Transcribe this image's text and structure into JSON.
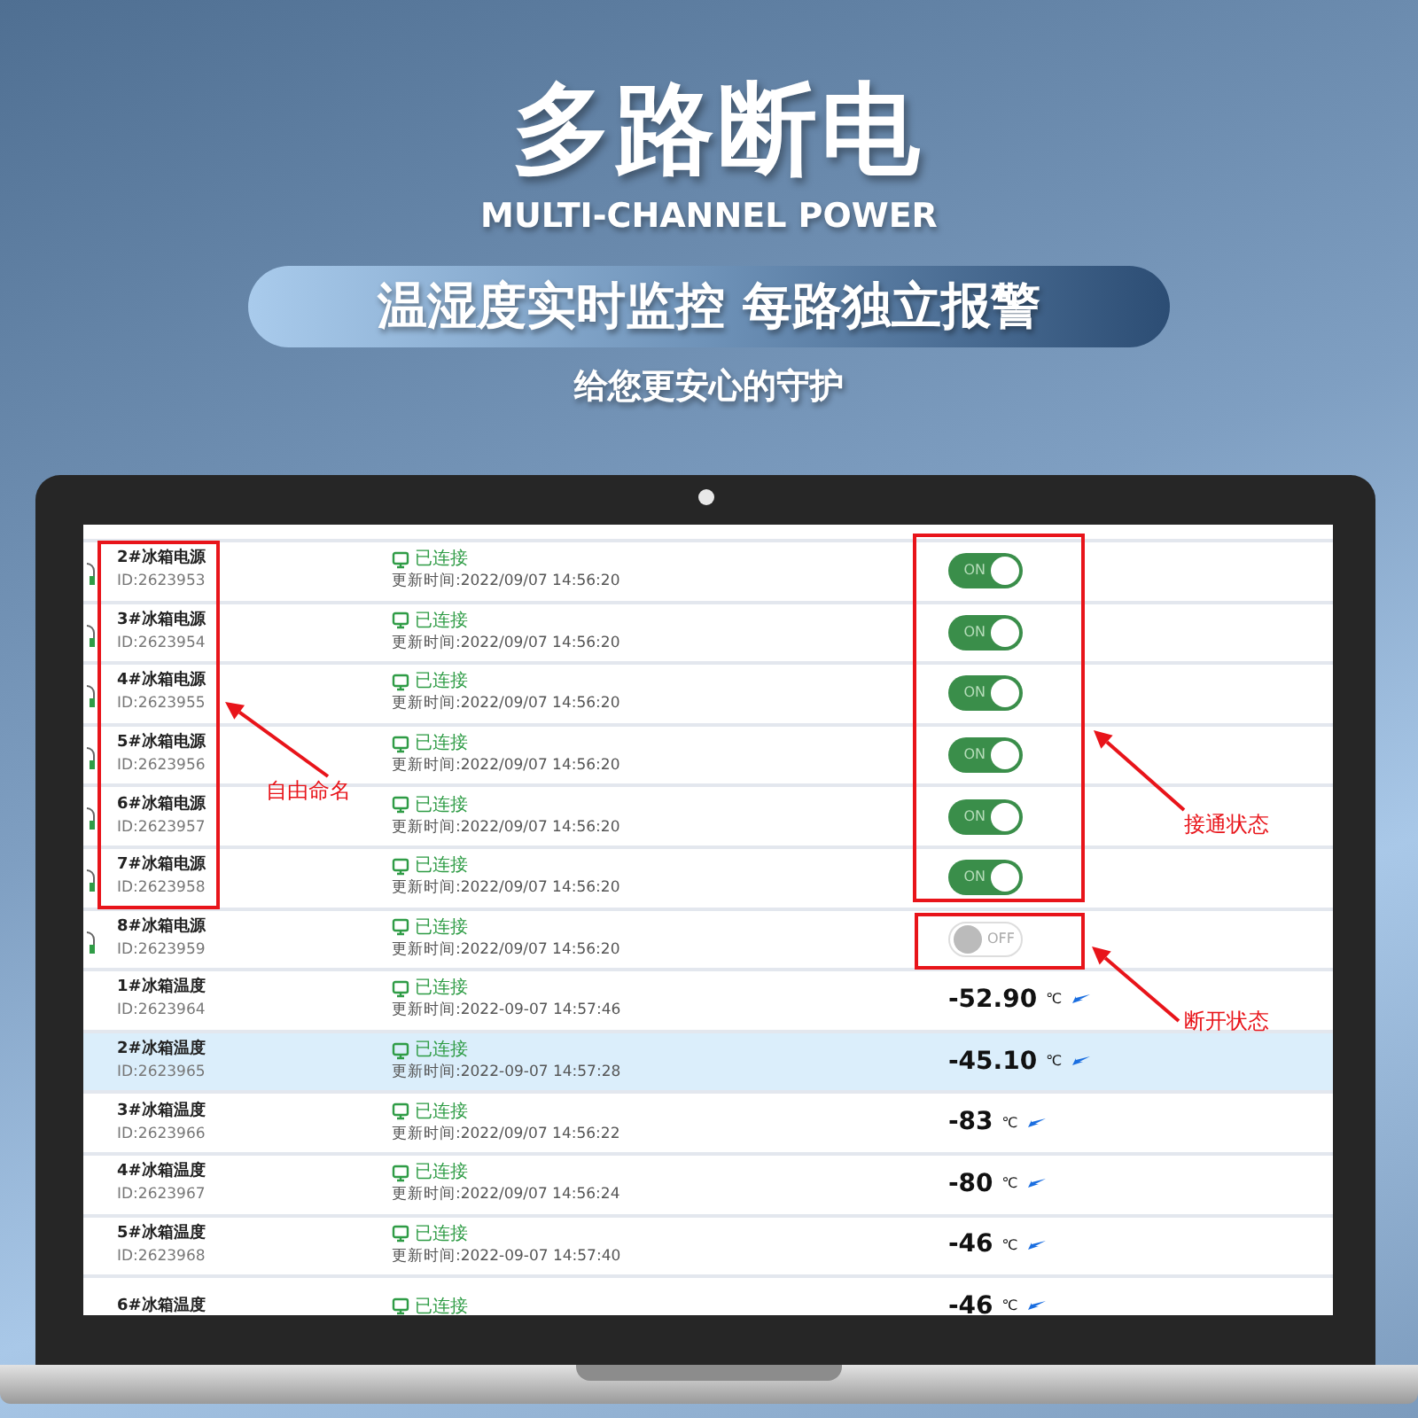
{
  "banner": {
    "title": "多路断电",
    "subtitle": "MULTI-CHANNEL POWER",
    "pill": "温湿度实时监控 每路独立报警",
    "tagline": "给您更安心的守护"
  },
  "rows": [
    {
      "kind": "switch",
      "name": "2#冰箱电源",
      "id": "ID:2623953",
      "status": "已连接",
      "time": "更新时间:2022/09/07 14:56:20",
      "on": true,
      "switch_label": "ON",
      "selected": false
    },
    {
      "kind": "switch",
      "name": "3#冰箱电源",
      "id": "ID:2623954",
      "status": "已连接",
      "time": "更新时间:2022/09/07 14:56:20",
      "on": true,
      "switch_label": "ON",
      "selected": false
    },
    {
      "kind": "switch",
      "name": "4#冰箱电源",
      "id": "ID:2623955",
      "status": "已连接",
      "time": "更新时间:2022/09/07 14:56:20",
      "on": true,
      "switch_label": "ON",
      "selected": false
    },
    {
      "kind": "switch",
      "name": "5#冰箱电源",
      "id": "ID:2623956",
      "status": "已连接",
      "time": "更新时间:2022/09/07 14:56:20",
      "on": true,
      "switch_label": "ON",
      "selected": false
    },
    {
      "kind": "switch",
      "name": "6#冰箱电源",
      "id": "ID:2623957",
      "status": "已连接",
      "time": "更新时间:2022/09/07 14:56:20",
      "on": true,
      "switch_label": "ON",
      "selected": false
    },
    {
      "kind": "switch",
      "name": "7#冰箱电源",
      "id": "ID:2623958",
      "status": "已连接",
      "time": "更新时间:2022/09/07 14:56:20",
      "on": true,
      "switch_label": "ON",
      "selected": false
    },
    {
      "kind": "switch",
      "name": "8#冰箱电源",
      "id": "ID:2623959",
      "status": "已连接",
      "time": "更新时间:2022/09/07 14:56:20",
      "on": false,
      "switch_label": "OFF",
      "selected": false
    },
    {
      "kind": "temperature",
      "name": "1#冰箱温度",
      "id": "ID:2623964",
      "status": "已连接",
      "time": "更新时间:2022-09-07 14:57:46",
      "value": "-52.90",
      "unit": "℃",
      "selected": false
    },
    {
      "kind": "temperature",
      "name": "2#冰箱温度",
      "id": "ID:2623965",
      "status": "已连接",
      "time": "更新时间:2022-09-07 14:57:28",
      "value": "-45.10",
      "unit": "℃",
      "selected": true
    },
    {
      "kind": "temperature",
      "name": "3#冰箱温度",
      "id": "ID:2623966",
      "status": "已连接",
      "time": "更新时间:2022/09/07 14:56:22",
      "value": "-83",
      "unit": "℃",
      "selected": false
    },
    {
      "kind": "temperature",
      "name": "4#冰箱温度",
      "id": "ID:2623967",
      "status": "已连接",
      "time": "更新时间:2022/09/07 14:56:24",
      "value": "-80",
      "unit": "℃",
      "selected": false
    },
    {
      "kind": "temperature",
      "name": "5#冰箱温度",
      "id": "ID:2623968",
      "status": "已连接",
      "time": "更新时间:2022-09-07 14:57:40",
      "value": "-46",
      "unit": "℃",
      "selected": false
    },
    {
      "kind": "temperature",
      "name": "6#冰箱温度",
      "status": "已连接",
      "value": "-46",
      "unit": "℃",
      "selected": false
    }
  ],
  "annotations": [
    {
      "label": "自由命名"
    },
    {
      "label": "接通状态"
    },
    {
      "label": "断开状态"
    }
  ]
}
